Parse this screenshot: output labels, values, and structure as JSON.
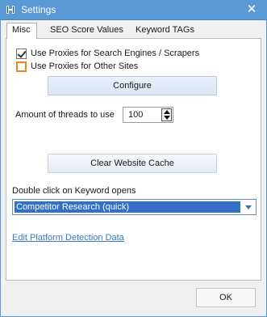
{
  "window": {
    "title": "Settings",
    "close_glyph": "✕"
  },
  "tabs": [
    {
      "label": "Misc",
      "active": true
    },
    {
      "label": "SEO Score Values",
      "active": false
    },
    {
      "label": "Keyword TAGs",
      "active": false
    }
  ],
  "misc": {
    "use_proxies_search": {
      "label": "Use Proxies for Search Engines / Scrapers",
      "checked": true
    },
    "use_proxies_other": {
      "label": "Use Proxies for Other Sites",
      "checked": false
    },
    "configure_label": "Configure",
    "threads_label": "Amount of threads to use",
    "threads_value": "100",
    "clear_cache_label": "Clear Website Cache",
    "double_click_label": "Double click on Keyword opens",
    "double_click_value": "Competitor Research (quick)",
    "edit_platform_link": "Edit Platform Detection Data"
  },
  "footer": {
    "ok_label": "OK"
  },
  "colors": {
    "titlebar": "#5a9ad4",
    "select_highlight": "#3370c8",
    "link": "#3478c6",
    "orange_focus": "#e8891f"
  },
  "icons": {
    "app": "app-logo-icon",
    "close": "close-icon",
    "spin_up": "arrow-up-icon",
    "spin_down": "arrow-down-icon",
    "dropdown": "chevron-down-icon"
  }
}
